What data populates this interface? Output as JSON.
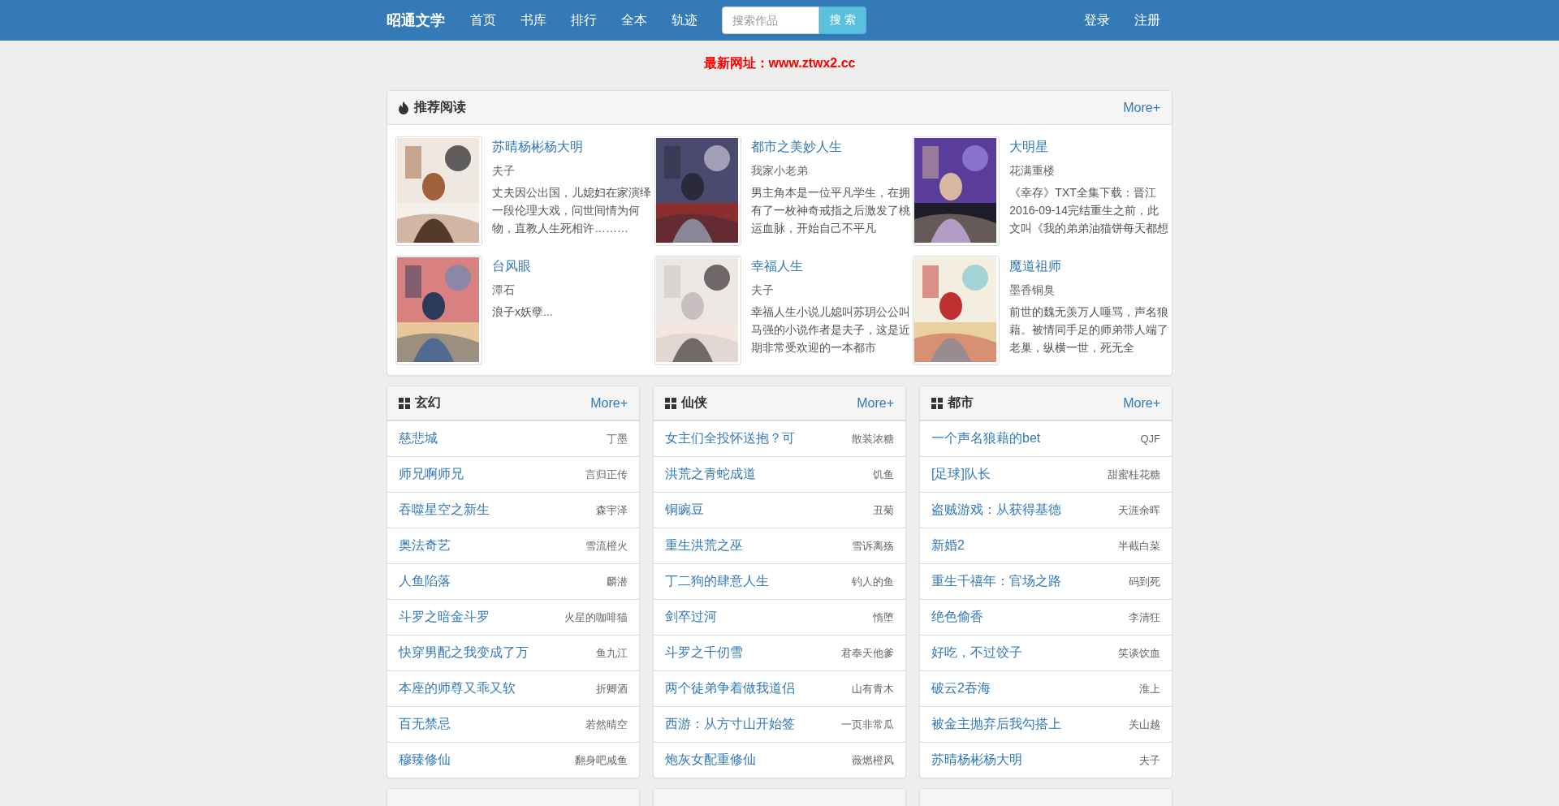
{
  "navbar": {
    "brand": "昭通文学",
    "links": [
      {
        "label": "首页",
        "selected": false
      },
      {
        "label": "书库",
        "selected": false
      },
      {
        "label": "排行",
        "selected": false
      },
      {
        "label": "全本",
        "selected": false
      },
      {
        "label": "轨迹",
        "selected": false
      }
    ],
    "search": {
      "placeholder": "搜索作品",
      "button": "搜 索"
    },
    "user_links": [
      "登录",
      "注册"
    ]
  },
  "notice": "最新网址：www.ztwx2.cc",
  "recommend": {
    "title": "推荐阅读",
    "more": "More+",
    "books": [
      {
        "title": "苏晴杨彬杨大明",
        "author": "夫子",
        "intro": "丈夫因公出国，儿媳妇在家演绎一段伦理大戏，问世间情为何物，直教人生死相许………"
      },
      {
        "title": "都市之美妙人生",
        "author": "我家小老弟",
        "intro": "男主角本是一位平凡学生，在拥有了一枚神奇戒指之后激发了桃运血脉，开始自己不平凡"
      },
      {
        "title": "大明星",
        "author": "花满重楼",
        "intro": "《幸存》TXT全集下载：晋江2016-09-14完结重生之前，此文叫《我的弟弟油猫饼每天都想"
      },
      {
        "title": "台风眼",
        "author": "潭石",
        "intro": "浪子x妖孽..."
      },
      {
        "title": "幸福人生",
        "author": "夫子",
        "intro": "幸福人生小说儿媳叫苏玥公公叫马强的小说作者是夫子，这是近期非常受欢迎的一本都市"
      },
      {
        "title": "魔道祖师",
        "author": "墨香铜臭",
        "intro": "前世的魏无羡万人唾骂，声名狼藉。被情同手足的师弟带人端了老巢，纵横一世，死无全"
      }
    ]
  },
  "categories": [
    {
      "title": "玄幻",
      "more": "More+",
      "books": [
        {
          "title": "慈悲城",
          "author": "丁墨"
        },
        {
          "title": "师兄啊师兄",
          "author": "言归正传"
        },
        {
          "title": "吞噬星空之新生",
          "author": "森宇泽"
        },
        {
          "title": "奥法奇艺",
          "author": "雪流橙火"
        },
        {
          "title": "人鱼陷落",
          "author": "麟潜"
        },
        {
          "title": "斗罗之暗金斗罗",
          "author": "火星的咖啡猫"
        },
        {
          "title": "快穿男配之我变成了万",
          "author": "鱼九江"
        },
        {
          "title": "本座的师尊又乖又软",
          "author": "折卿酒"
        },
        {
          "title": "百无禁忌",
          "author": "若然晴空"
        },
        {
          "title": "穆臻修仙",
          "author": "翻身吧咸鱼"
        }
      ]
    },
    {
      "title": "仙侠",
      "more": "More+",
      "books": [
        {
          "title": "女主们全投怀送抱？可",
          "author": "散装浓糖"
        },
        {
          "title": "洪荒之青蛇成道",
          "author": "饥鱼"
        },
        {
          "title": "铜豌豆",
          "author": "丑菊"
        },
        {
          "title": "重生洪荒之巫",
          "author": "雪诉离殇"
        },
        {
          "title": "丁二狗的肆意人生",
          "author": "钓人的鱼"
        },
        {
          "title": "剑卒过河",
          "author": "惰堕"
        },
        {
          "title": "斗罗之千仞雪",
          "author": "君奉天他爹"
        },
        {
          "title": "两个徒弟争着做我道侣",
          "author": "山有青木"
        },
        {
          "title": "西游：从方寸山开始签",
          "author": "一页非常瓜"
        },
        {
          "title": "炮灰女配重修仙",
          "author": "薇燃橙风"
        }
      ]
    },
    {
      "title": "都市",
      "more": "More+",
      "books": [
        {
          "title": "一个声名狼藉的bet",
          "author": "QJF"
        },
        {
          "title": "[足球]队长",
          "author": "甜蜜桂花糖"
        },
        {
          "title": "盗贼游戏：从获得基德",
          "author": "天涯余晖"
        },
        {
          "title": "新婚2",
          "author": "半截白菜"
        },
        {
          "title": "重生千禧年：官场之路",
          "author": "码到死"
        },
        {
          "title": "绝色偷香",
          "author": "李清狂"
        },
        {
          "title": "好吃，不过饺子",
          "author": "笑谈饮血"
        },
        {
          "title": "破云2吞海",
          "author": "淮上"
        },
        {
          "title": "被金主抛弃后我勾搭上",
          "author": "关山越"
        },
        {
          "title": "苏晴杨彬杨大明",
          "author": "夫子"
        }
      ]
    }
  ]
}
